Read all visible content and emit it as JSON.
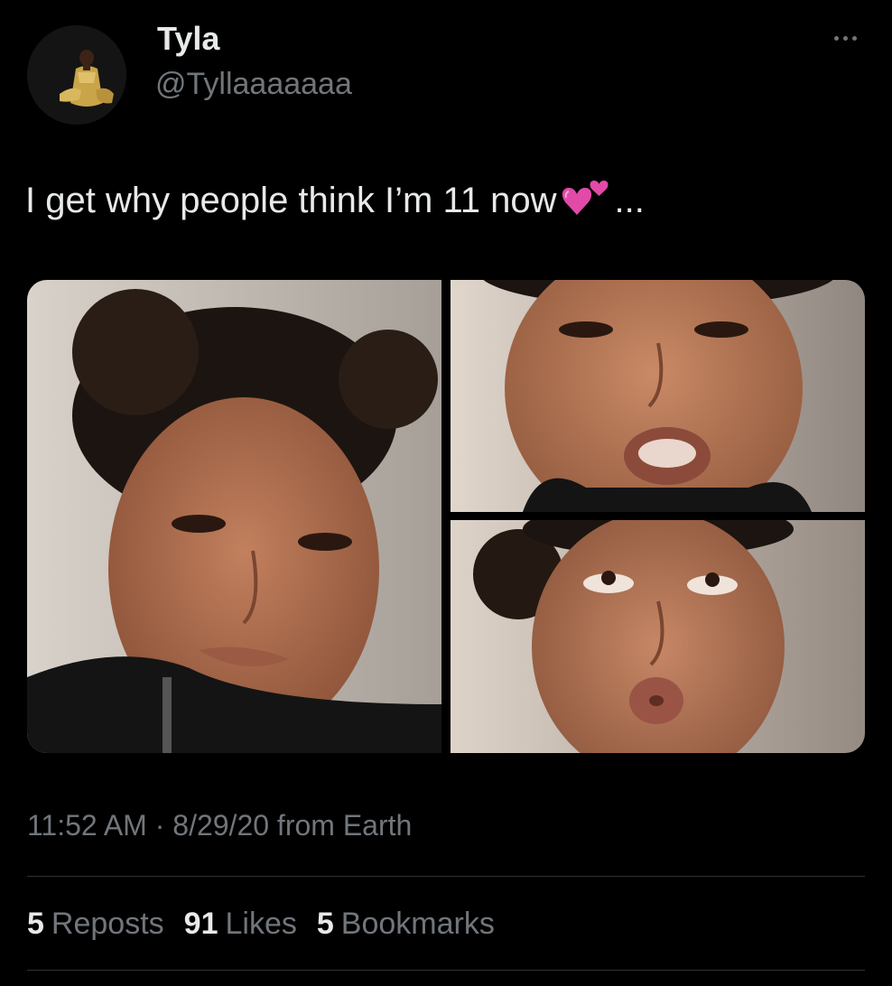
{
  "author": {
    "display_name": "Tyla",
    "handle": "@Tyllaaaaaaa",
    "avatar_icon": "profile-photo"
  },
  "menu": {
    "icon": "more-horizontal-icon"
  },
  "tweet": {
    "text_before": "I get why people think I’m 11 now",
    "emoji": "two-hearts-icon",
    "text_after": "...",
    "photos": [
      {
        "name": "photo-1"
      },
      {
        "name": "photo-2"
      },
      {
        "name": "photo-3"
      }
    ]
  },
  "meta": {
    "time": "11:52 AM",
    "separator": "·",
    "date": "8/29/20",
    "source": "from Earth"
  },
  "stats": {
    "reposts_count": "5",
    "reposts_label": "Reposts",
    "likes_count": "91",
    "likes_label": "Likes",
    "bookmarks_count": "5",
    "bookmarks_label": "Bookmarks"
  },
  "colors": {
    "background": "#000000",
    "primary_text": "#e7e9ea",
    "secondary_text": "#71767b",
    "divider": "#2f3336",
    "heart": "#e24aa8"
  }
}
